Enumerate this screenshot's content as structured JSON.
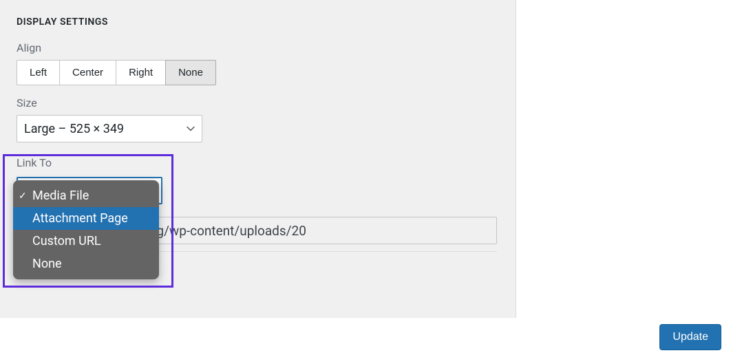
{
  "section_title": "DISPLAY SETTINGS",
  "align": {
    "label": "Align",
    "options": [
      "Left",
      "Center",
      "Right",
      "None"
    ],
    "selected": "None"
  },
  "size": {
    "label": "Size",
    "selected": "Large – 525 × 349"
  },
  "link_to": {
    "label": "Link To",
    "options": [
      {
        "label": "Media File",
        "checked": true,
        "highlighted": false
      },
      {
        "label": "Attachment Page",
        "checked": false,
        "highlighted": true
      },
      {
        "label": "Custom URL",
        "checked": false,
        "highlighted": false
      },
      {
        "label": "None",
        "checked": false,
        "highlighted": false
      }
    ],
    "url_value": "8b8.eu1.wpsandbox.org/wp-content/uploads/20"
  },
  "update_button": "Update",
  "colors": {
    "highlight_border": "#5e2cda",
    "primary": "#2271b1"
  }
}
